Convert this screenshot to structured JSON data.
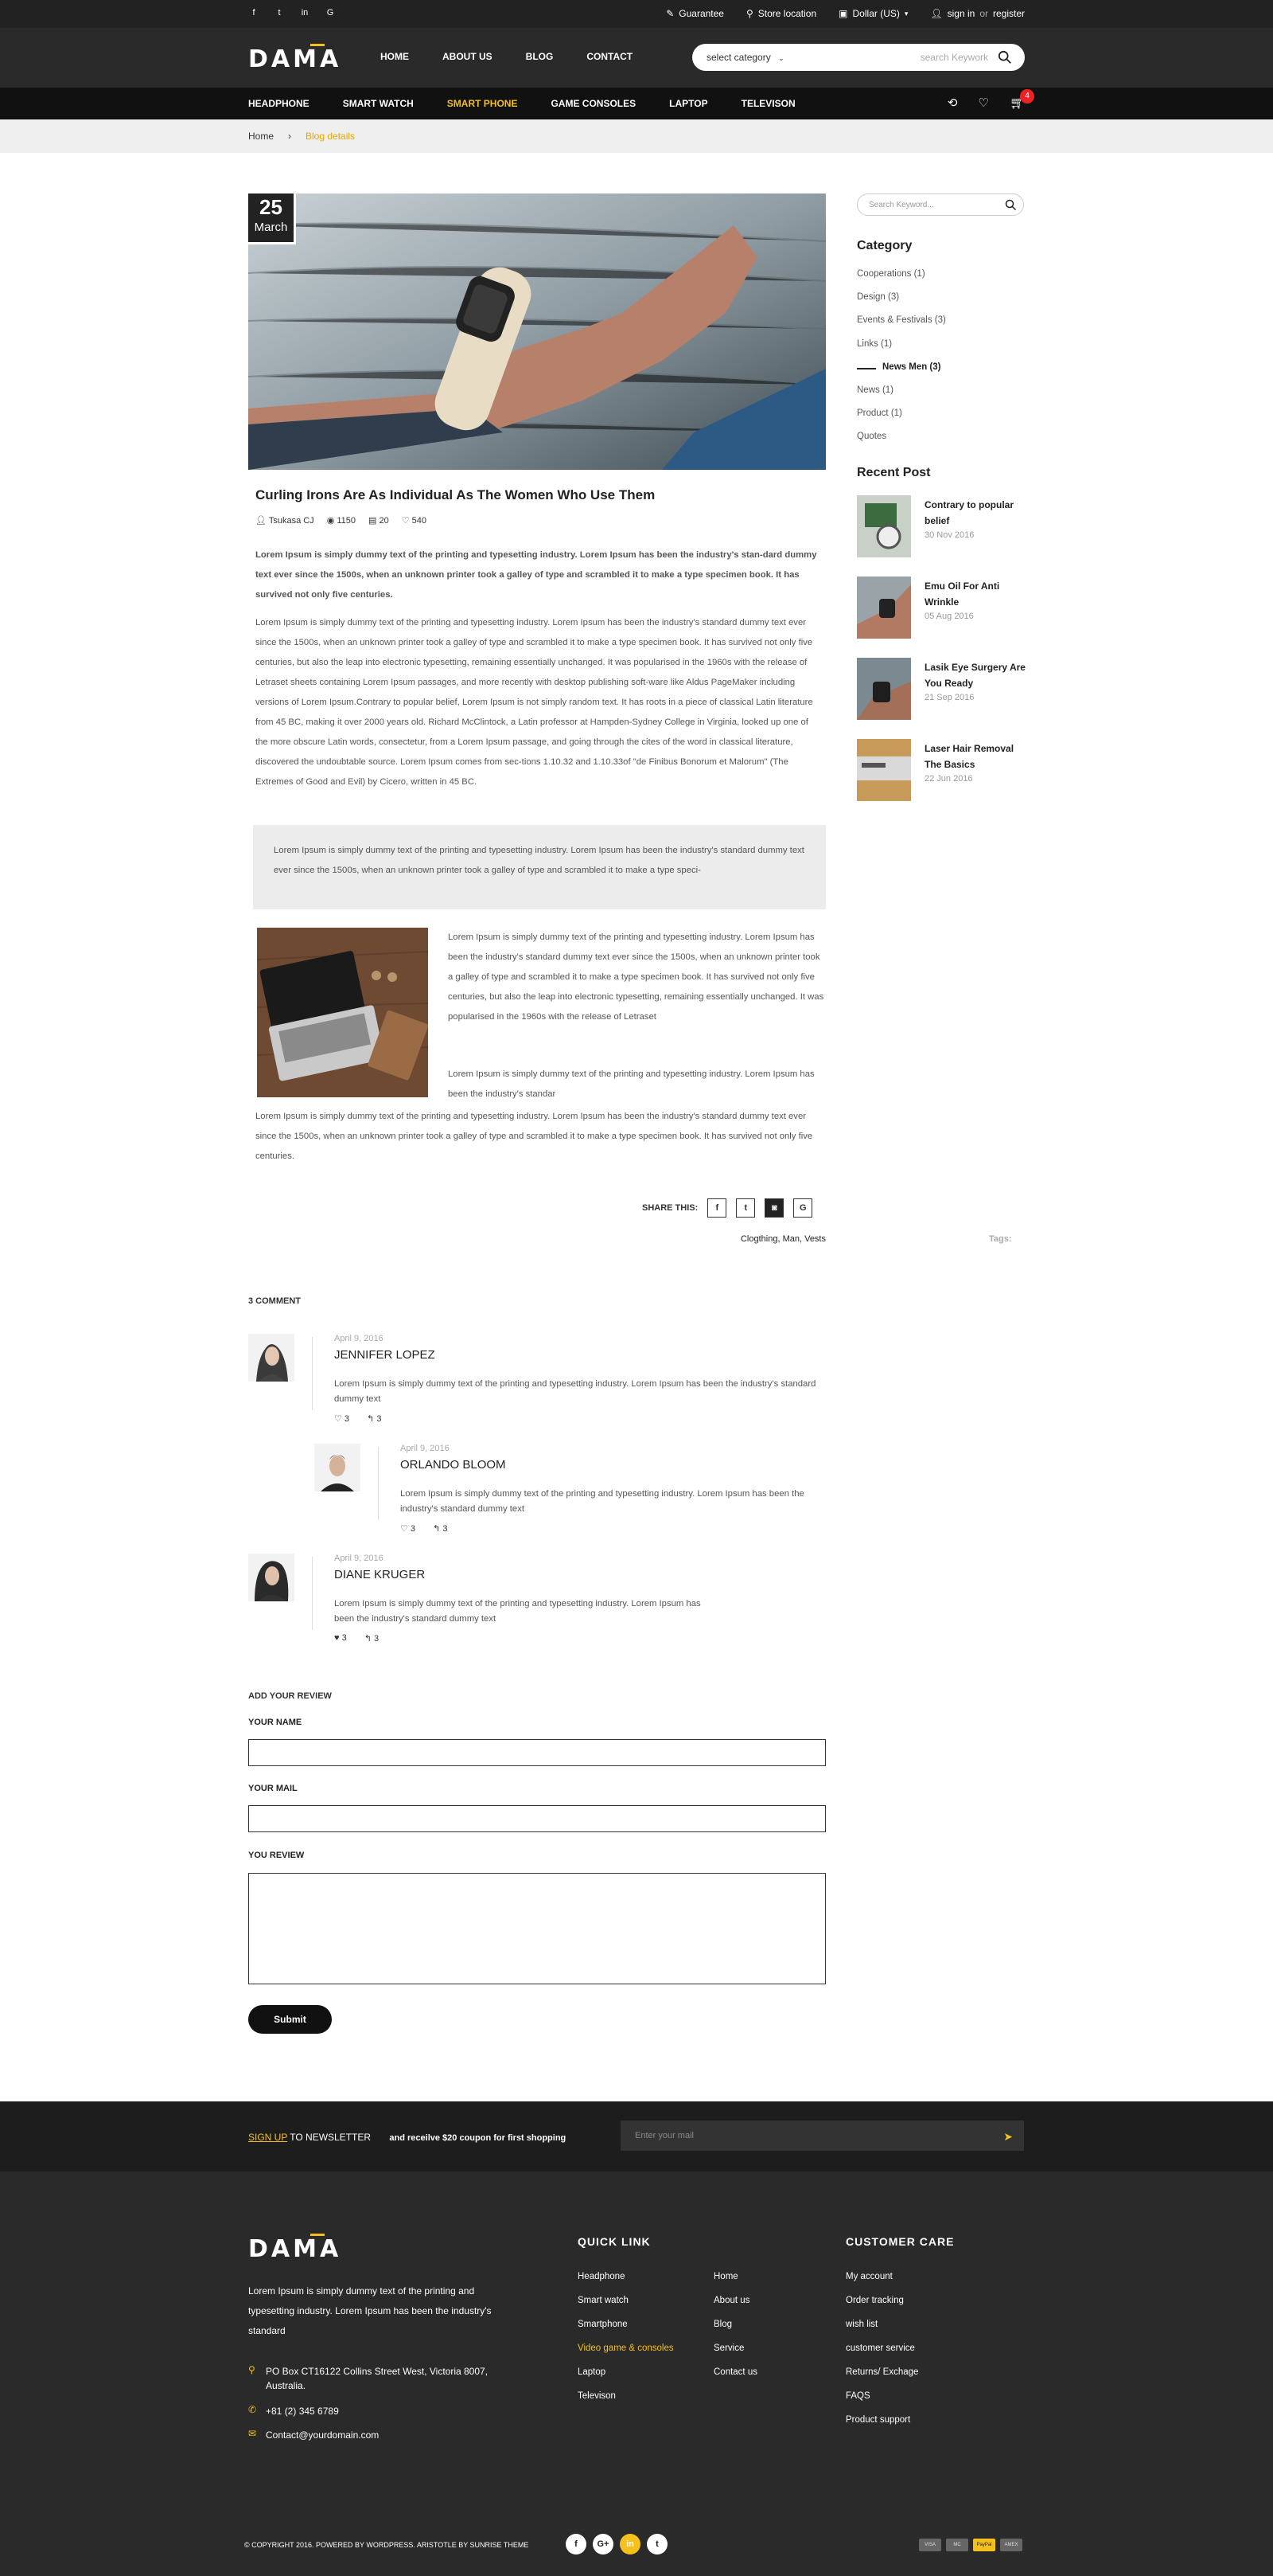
{
  "topbar": {
    "social": [
      "f",
      "t",
      "in",
      "G"
    ],
    "guarantee": "Guarantee",
    "store": "Store location",
    "currency": "Dollar (US)",
    "sign_in": "sign in",
    "or": "or",
    "register": "register"
  },
  "header": {
    "logo": "DAMA",
    "nav": [
      "HOME",
      "ABOUT US",
      "BLOG",
      "CONTACT"
    ],
    "select_category": "select category",
    "search_placeholder": "search Keywork"
  },
  "catbar": {
    "items": [
      "HEADPHONE",
      "SMART WATCH",
      "SMART PHONE",
      "GAME CONSOLES",
      "LAPTOP",
      "TELEVISON"
    ],
    "active": "SMART PHONE",
    "cart_count": "4"
  },
  "breadcrumb": {
    "home": "Home",
    "current": "Blog details"
  },
  "article": {
    "date_day": "25",
    "date_month": "March",
    "title": "Curling Irons Are As Individual As The Women Who Use Them",
    "author": "Tsukasa CJ",
    "views": "1150",
    "comments": "20",
    "likes": "540",
    "intro": "Lorem Ipsum is simply dummy text of the printing and typesetting industry. Lorem Ipsum has been the industry's stan-dard dummy text ever since the 1500s, when an unknown printer took a galley of type and scrambled it to make a type specimen book. It has survived not only five centuries.",
    "body": "Lorem Ipsum is simply dummy text of the printing and typesetting industry. Lorem Ipsum has been the industry's standard dummy text ever since the 1500s, when an unknown printer took a galley of type and scrambled it to make a type specimen book. It has survived not only five centuries, but also the leap into electronic typesetting, remaining essentially unchanged. It was popularised in the 1960s with the release of Letraset sheets containing Lorem Ipsum passages, and more recently with desktop publishing soft-ware like Aldus PageMaker including versions of Lorem Ipsum.Contrary to popular belief, Lorem Ipsum is not simply random text. It has roots in a piece of classical Latin literature from 45 BC, making it over 2000 years old. Richard McClintock, a Latin professor at Hampden-Sydney College in Virginia, looked up one of the more obscure Latin words, consectetur, from a Lorem Ipsum passage, and going through the cites of the word in classical literature, discovered the undoubtable source. Lorem Ipsum comes from sec-tions 1.10.32 and 1.10.33of \"de Finibus Bonorum et Malorum\" (The Extremes of Good and Evil) by Cicero, written in 45 BC.",
    "quote": "Lorem Ipsum is simply dummy text of the printing and typesetting industry. Lorem Ipsum has been the industry's standard dummy text ever since the 1500s, when an unknown printer took a galley of type and scrambled it to make a type speci-",
    "side1": "Lorem Ipsum is simply dummy text of the printing and typesetting industry. Lorem Ipsum has been the industry's standard dummy text ever since the 1500s, when an unknown printer took a galley of type and scrambled it to make a type specimen book. It has survived not only five centuries, but also the leap into electronic typesetting, remaining essentially unchanged. It was popularised in the 1960s with the release of Letraset",
    "side2": "Lorem Ipsum is simply dummy text of the printing and typesetting industry. Lorem Ipsum has been the industry's standar",
    "closing": "Lorem Ipsum is simply dummy text of the printing and typesetting industry. Lorem Ipsum has been the industry's standard dummy text ever since the 1500s, when an unknown printer took a galley of type and scrambled it to make a type specimen book. It has survived not only five centuries.",
    "share_label": "SHARE THIS:",
    "tags_label": "Tags:",
    "tags": "Clogthing, Man, Vests"
  },
  "comments": {
    "heading": "3 COMMENT",
    "items": [
      {
        "date": "April 9, 2016",
        "name": "JENNIFER LOPEZ",
        "text": "Lorem Ipsum is simply dummy text of the printing and typesetting industry. Lorem Ipsum has been the industry's standard dummy text",
        "likes": "3",
        "replies": "3"
      },
      {
        "date": "April 9, 2016",
        "name": "ORLANDO BLOOM",
        "text": "Lorem Ipsum is simply dummy text of the printing and typesetting industry. Lorem Ipsum has been the industry's standard dummy text",
        "likes": "3",
        "replies": "3"
      },
      {
        "date": "April 9, 2016",
        "name": "DIANE KRUGER",
        "text": "Lorem Ipsum is simply dummy text of the printing and typesetting industry. Lorem Ipsum has been the industry's standard dummy text",
        "likes": "3",
        "replies": "3"
      }
    ]
  },
  "review": {
    "heading": "ADD YOUR REVIEW",
    "name_label": "YOUR NAME",
    "mail_label": "YOUR MAIL",
    "review_label": "YOU REVIEW",
    "submit": "Submit"
  },
  "sidebar": {
    "search_placeholder": "Search Keyword...",
    "category_title": "Category",
    "categories": [
      "Cooperations (1)",
      "Design (3)",
      "Events & Festivals (3)",
      "Links (1)",
      "News Men (3)",
      "News (1)",
      "Product (1)",
      "Quotes"
    ],
    "recent_title": "Recent Post",
    "posts": [
      {
        "title": "Contrary to popular belief",
        "date": "30 Nov 2016"
      },
      {
        "title": "Emu Oil For Anti Wrinkle",
        "date": "05 Aug 2016"
      },
      {
        "title": "Lasik Eye Surgery Are You Ready",
        "date": "21 Sep 2016"
      },
      {
        "title": "Laser Hair Removal The Basics",
        "date": "22 Jun 2016"
      }
    ]
  },
  "newsletter": {
    "sign_up": "SIGN UP",
    "to": "TO NEWSLETTER",
    "message": "and receilve $20 coupon for first shopping",
    "placeholder": "Enter your mail"
  },
  "footer": {
    "logo": "DAMA",
    "about": "Lorem Ipsum is simply dummy text of the printing and typesetting industry. Lorem Ipsum has been the industry's standard",
    "address": "PO Box CT16122 Collins Street West, Victoria 8007, Australia.",
    "phone": "+81 (2) 345 6789",
    "email": "Contact@yourdomain.com",
    "quick_link_title": "QUICK LINK",
    "quick_col1": [
      "Headphone",
      "Smart watch",
      "Smartphone",
      "Video game & consoles",
      "Laptop",
      "Televison"
    ],
    "quick_col2": [
      "Home",
      "About us",
      "Blog",
      "Service",
      "Contact us"
    ],
    "care_title": "CUSTOMER CARE",
    "care": [
      "My account",
      "Order tracking",
      "wish list",
      "customer service",
      "Returns/ Exchage",
      "FAQS",
      "Product support"
    ],
    "copyright": "© COPYRIGHT 2016. POWERED BY WORDPRESS. ARISTOTLE  BY SUNRISE THEME",
    "social": [
      "f",
      "G+",
      "in",
      "t"
    ],
    "payments": [
      "VISA",
      "MC",
      "PayPal",
      "AMEX"
    ]
  },
  "colors": {
    "accent": "#f4c01c",
    "dark": "#2a2a2a",
    "black": "#111111",
    "badge": "#e22222"
  }
}
